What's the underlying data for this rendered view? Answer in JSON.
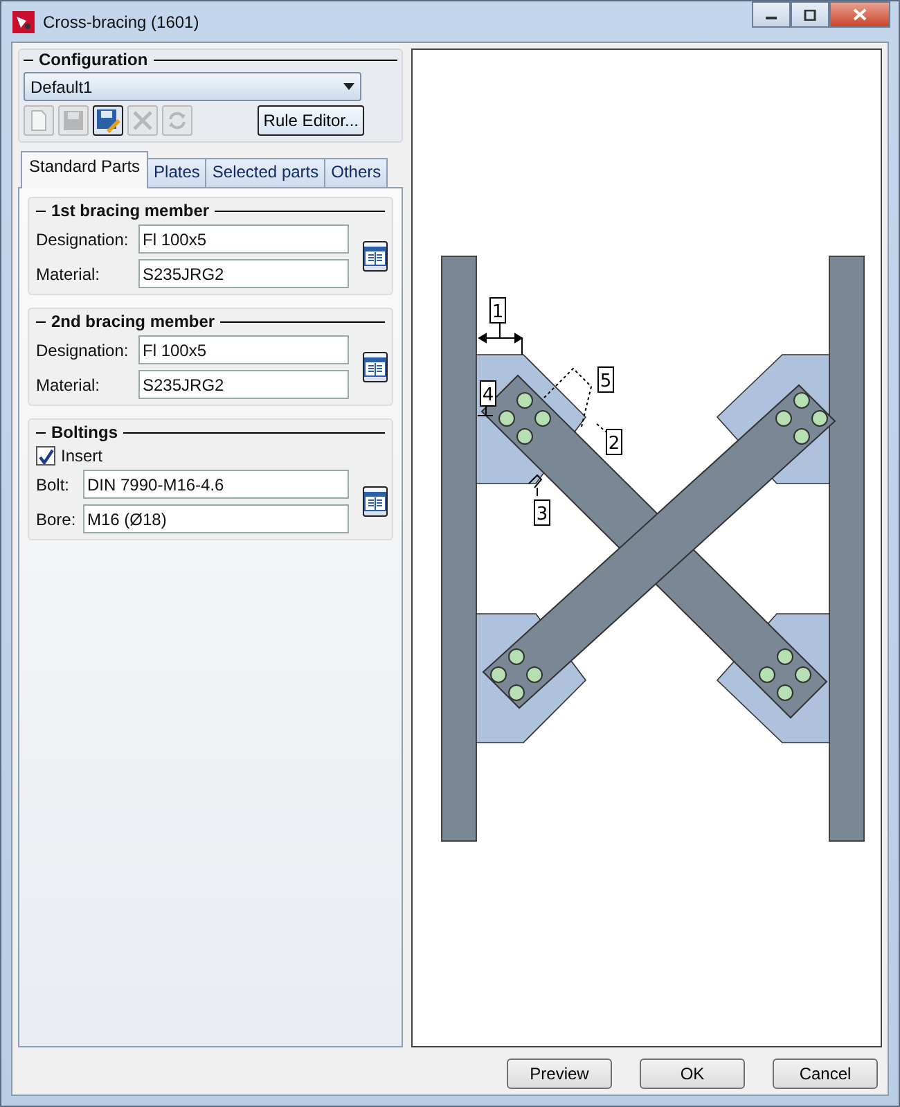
{
  "window": {
    "title": "Cross-bracing (1601)"
  },
  "configuration": {
    "title": "Configuration",
    "value": "Default1",
    "rule_editor": "Rule Editor...",
    "tools": [
      {
        "kind": "new",
        "disabled": true
      },
      {
        "kind": "save",
        "disabled": true
      },
      {
        "kind": "save-as",
        "disabled": false
      },
      {
        "kind": "delete",
        "disabled": true
      },
      {
        "kind": "refresh",
        "disabled": true
      }
    ]
  },
  "tabs": [
    {
      "label": "Standard Parts",
      "selected": true
    },
    {
      "label": "Plates",
      "selected": false
    },
    {
      "label": "Selected parts",
      "selected": false
    },
    {
      "label": "Others",
      "selected": false
    }
  ],
  "sections": [
    {
      "title": "1st bracing member",
      "fields": [
        {
          "label": "Designation:",
          "value": "Fl 100x5"
        },
        {
          "label": "Material:",
          "value": "S235JRG2"
        }
      ]
    },
    {
      "title": "2nd bracing member",
      "fields": [
        {
          "label": "Designation:",
          "value": "Fl 100x5"
        },
        {
          "label": "Material:",
          "value": "S235JRG2"
        }
      ]
    },
    {
      "title": "Boltings",
      "checkbox": {
        "label": "Insert",
        "checked": true
      },
      "fields": [
        {
          "label": "Bolt:",
          "value": "DIN 7990-M16-4.6"
        },
        {
          "label": "Bore:",
          "value": "M16 (Ø18)"
        }
      ]
    }
  ],
  "preview": {
    "dimension_labels": [
      "1",
      "2",
      "3",
      "4",
      "5"
    ]
  },
  "buttons": [
    "Preview",
    "OK",
    "Cancel"
  ]
}
